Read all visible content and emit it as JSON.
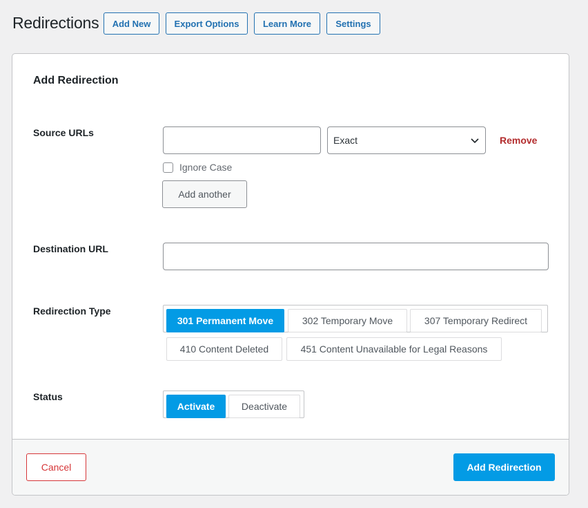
{
  "header": {
    "title": "Redirections",
    "buttons": [
      "Add New",
      "Export Options",
      "Learn More",
      "Settings"
    ]
  },
  "form": {
    "title": "Add Redirection",
    "source": {
      "label": "Source URLs",
      "url_value": "",
      "match_type": "Exact",
      "remove_label": "Remove",
      "ignore_case_label": "Ignore Case",
      "ignore_case_checked": false,
      "add_another_label": "Add another"
    },
    "destination": {
      "label": "Destination URL",
      "value": ""
    },
    "redirection_type": {
      "label": "Redirection Type",
      "options": [
        "301 Permanent Move",
        "302 Temporary Move",
        "307 Temporary Redirect",
        "410 Content Deleted",
        "451 Content Unavailable for Legal Reasons"
      ],
      "selected": "301 Permanent Move"
    },
    "status": {
      "label": "Status",
      "options": [
        "Activate",
        "Deactivate"
      ],
      "selected": "Activate"
    }
  },
  "footer": {
    "cancel_label": "Cancel",
    "submit_label": "Add Redirection"
  },
  "colors": {
    "accent": "#039be5",
    "link_blue": "#2271b1",
    "danger": "#d63638",
    "remove_red": "#b32d2e"
  }
}
